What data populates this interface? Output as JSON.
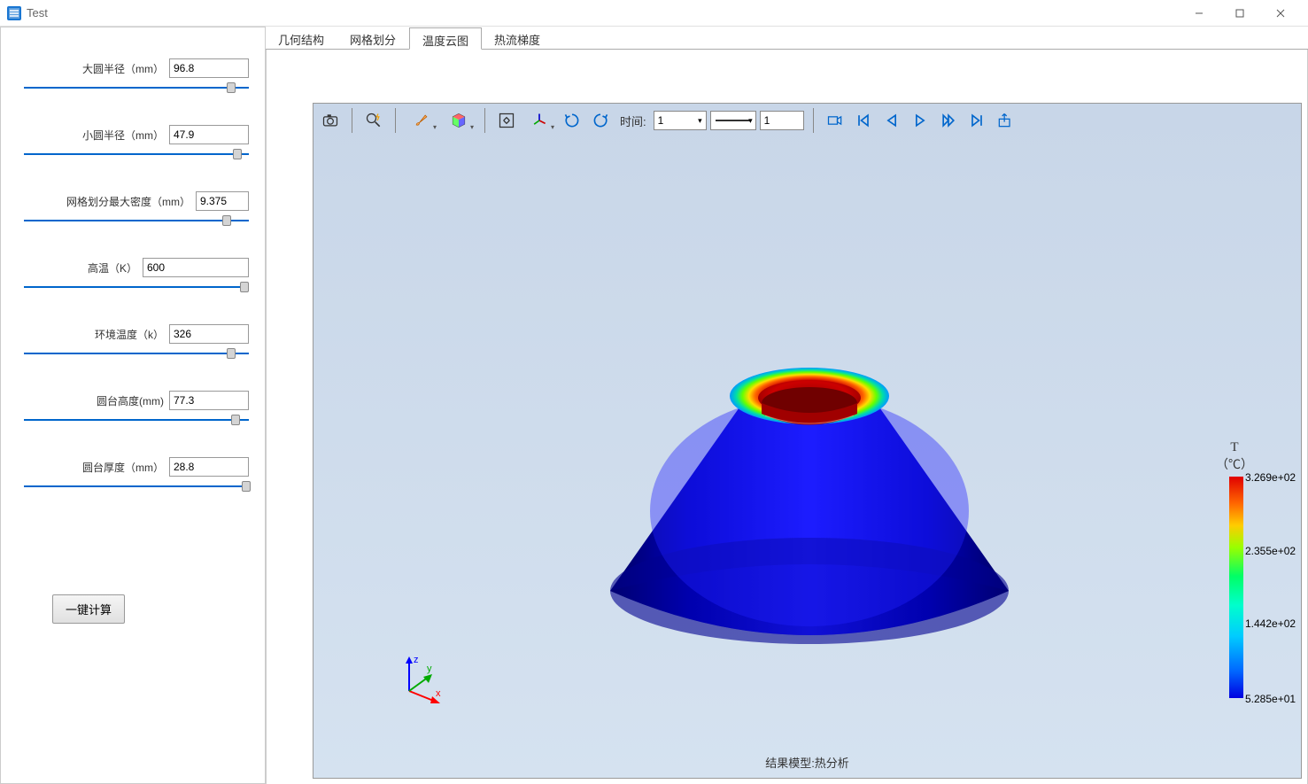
{
  "window": {
    "title": "Test"
  },
  "sidebar": {
    "params": [
      {
        "label": "大圆半径（mm）",
        "value": "96.8",
        "thumb": 90
      },
      {
        "label": "小圆半径（mm）",
        "value": "47.9",
        "thumb": 93
      },
      {
        "label": "网格划分最大密度（mm）",
        "value": "9.375",
        "thumb": 88,
        "narrow": true
      },
      {
        "label": "高温（K）",
        "value": "600",
        "thumb": 96,
        "medium": true
      },
      {
        "label": "环境温度（k）",
        "value": "326",
        "thumb": 90
      },
      {
        "label": "圆台高度(mm)",
        "value": "77.3",
        "thumb": 92
      },
      {
        "label": "圆台厚度（mm）",
        "value": "28.8",
        "thumb": 97
      }
    ],
    "calc_label": "一键计算"
  },
  "tabs": [
    {
      "label": "几何结构",
      "active": false
    },
    {
      "label": "网格划分",
      "active": false
    },
    {
      "label": "温度云图",
      "active": true
    },
    {
      "label": "热流梯度",
      "active": false
    }
  ],
  "toolbar": {
    "time_label": "时间:",
    "time_value": "1",
    "spin_value": "1"
  },
  "colorbar": {
    "title": "T",
    "unit": "（℃）",
    "labels": [
      {
        "text": "3.269e+02",
        "pos": 0
      },
      {
        "text": "2.355e+02",
        "pos": 33
      },
      {
        "text": "1.442e+02",
        "pos": 66
      },
      {
        "text": "5.285e+01",
        "pos": 100
      }
    ]
  },
  "footer": {
    "label": "结果模型:热分析"
  },
  "axes": {
    "x": "x",
    "y": "y",
    "z": "z"
  }
}
